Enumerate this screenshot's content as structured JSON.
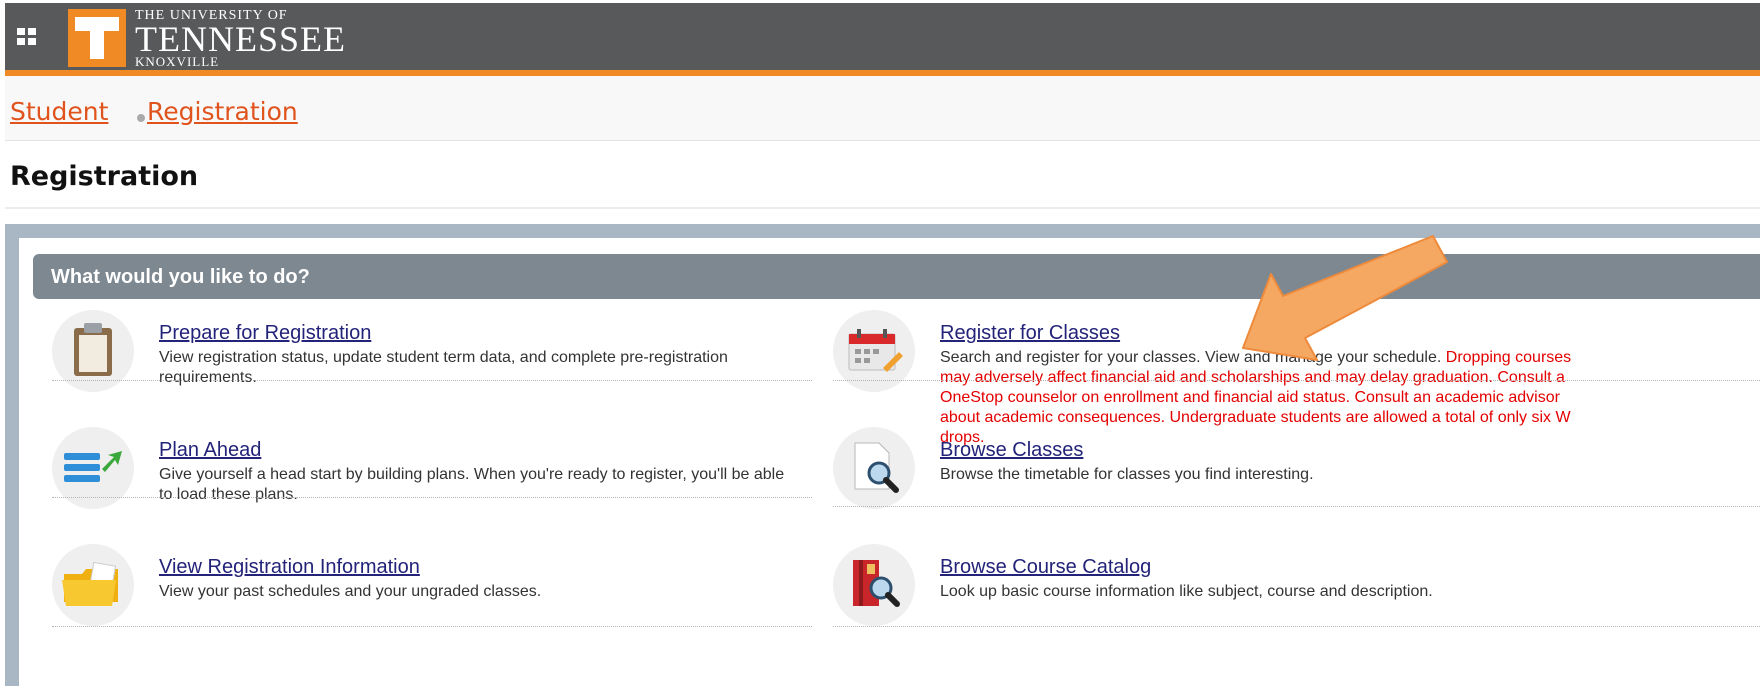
{
  "header": {
    "logo_line1": "THE UNIVERSITY OF",
    "logo_line2": "TENNESSEE",
    "logo_line3": "KNOXVILLE",
    "logo_letter": "T",
    "grid_icon": "grid-menu-icon",
    "accent_color": "#f08a24",
    "bar_color": "#57595b"
  },
  "breadcrumb": {
    "items": [
      "Student",
      "Registration"
    ]
  },
  "page": {
    "title": "Registration"
  },
  "panel": {
    "header": "What would you like to do?"
  },
  "cards": [
    {
      "title": "Prepare for Registration",
      "description": "View registration status, update student term data, and complete pre-registration requirements.",
      "icon": "clipboard-icon"
    },
    {
      "title": "Register for Classes",
      "description": "Search and register for your classes. View and manage your schedule.",
      "warning": "Dropping courses may adversely affect financial aid and scholarships and may delay graduation. Consult a OneStop counselor on enrollment and financial aid status. Consult an academic advisor about academic consequences. Undergraduate students are allowed a total of only six W drops.",
      "icon": "calendar-icon"
    },
    {
      "title": "Plan Ahead",
      "description": "Give yourself a head start by building plans. When you're ready to register, you'll be able to load these plans.",
      "icon": "plan-list-icon"
    },
    {
      "title": "Browse Classes",
      "description": "Browse the timetable for classes you find interesting.",
      "icon": "document-search-icon"
    },
    {
      "title": "View Registration Information",
      "description": "View your past schedules and your ungraded classes.",
      "icon": "folder-icon"
    },
    {
      "title": "Browse Course Catalog",
      "description": "Look up basic course information like subject, course and description.",
      "icon": "book-search-icon"
    }
  ],
  "colors": {
    "link": "#23237a",
    "breadcrumb_link": "#e0531d",
    "warning": "#e50000",
    "arrow": "#f5a862"
  }
}
